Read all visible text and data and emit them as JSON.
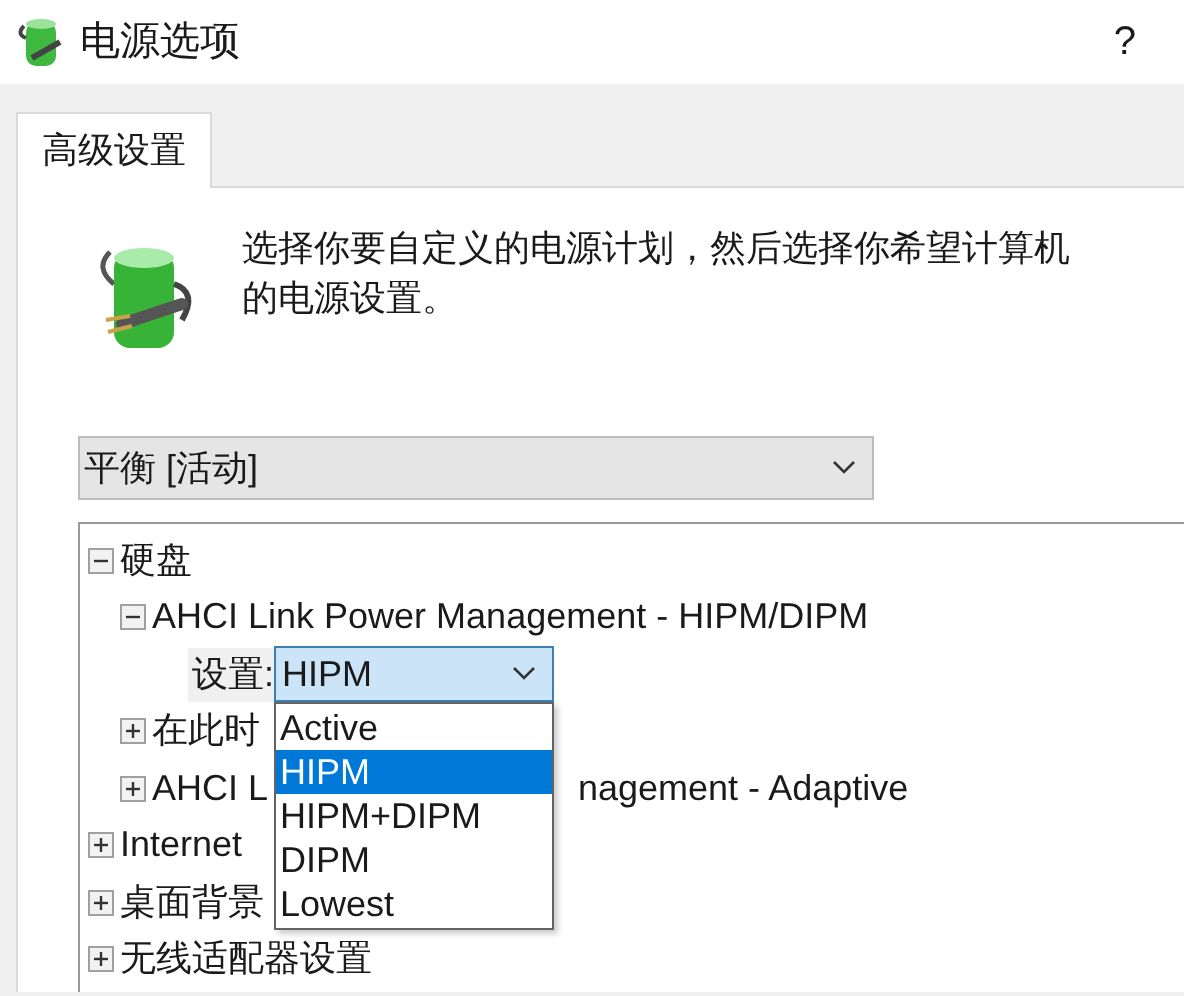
{
  "window": {
    "title": "电源选项",
    "help": "?"
  },
  "tabs": [
    {
      "label": "高级设置",
      "selected": true
    }
  ],
  "description_lines": [
    "选择你要自定义的电源计划，然后选择你希望计算机",
    "的电源设置。"
  ],
  "plan_select": {
    "value": "平衡 [活动]"
  },
  "settings_tree": [
    {
      "kind": "group",
      "label": "硬盘",
      "expanded": true,
      "children": [
        {
          "kind": "group",
          "label": "AHCI Link Power Management - HIPM/DIPM",
          "expanded": true,
          "children": [
            {
              "kind": "setting",
              "label": "设置:",
              "value": "HIPM",
              "open": true,
              "options": [
                {
                  "label": "Active",
                  "selected": false
                },
                {
                  "label": "HIPM",
                  "selected": true
                },
                {
                  "label": "HIPM+DIPM",
                  "selected": false
                },
                {
                  "label": "DIPM",
                  "selected": false
                },
                {
                  "label": "Lowest",
                  "selected": false
                }
              ]
            }
          ]
        },
        {
          "kind": "group",
          "label": "在此时",
          "expanded": false
        },
        {
          "kind": "group",
          "label": "AHCI L",
          "label_after": "nagement - Adaptive",
          "expanded": false
        }
      ]
    },
    {
      "kind": "group",
      "label": "Internet",
      "expanded": false
    },
    {
      "kind": "group",
      "label": "桌面背景",
      "expanded": false
    },
    {
      "kind": "group",
      "label": "无线适配器设置",
      "expanded": false
    }
  ]
}
